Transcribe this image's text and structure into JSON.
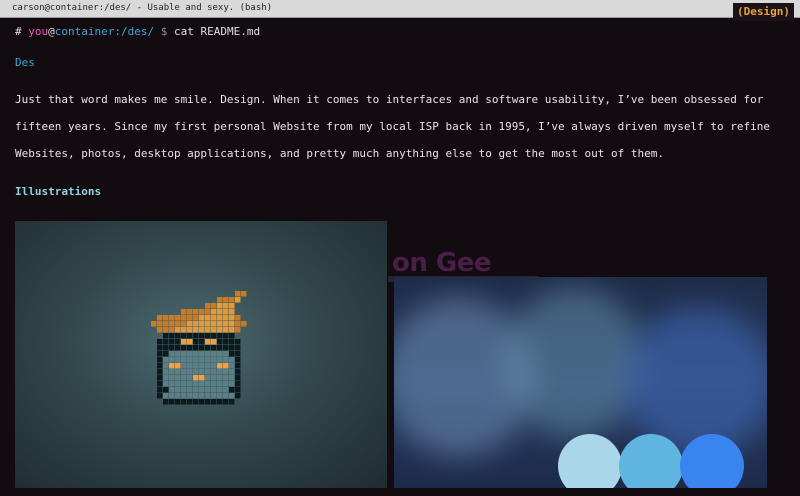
{
  "window": {
    "title": "carson@container:/des/ - Usable and sexy. (bash)",
    "badge": "(Design)"
  },
  "prompt": {
    "hash": "#",
    "user": "you",
    "at": "@",
    "host": "container",
    "path": ":/des/",
    "dollar": "$",
    "command": "cat README.md"
  },
  "content": {
    "heading": "Des",
    "paragraph": "Just that word makes me smile. Design. When it comes to interfaces and software usability, I’ve been obsessed for fifteen years. Since my first personal Website from my local ISP back in 1995, I’ve always driven myself to refine Websites, photos, desktop applications, and pretty much anything else to get the most out of them.",
    "section": "Illustrations",
    "background_text": "on Gee"
  },
  "colors": {
    "background": "#120c11",
    "accent_blue": "#3fa6d9",
    "accent_pink": "#e75fb4",
    "accent_orange": "#e8a33a",
    "heading_cyan": "#8fd3df"
  },
  "images": {
    "illustration_1": "pixel-art-black-mage",
    "illustration_2": "blue-bokeh-circles"
  }
}
